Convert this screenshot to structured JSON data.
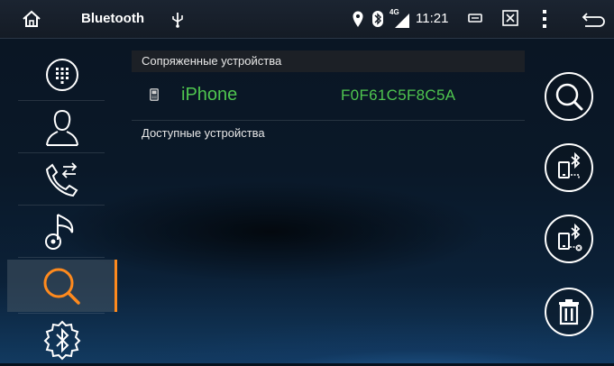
{
  "statusbar": {
    "title": "Bluetooth",
    "time": "11:21",
    "network": "4G",
    "icons": [
      "home-icon",
      "usb-icon",
      "location-icon",
      "bluetooth-icon",
      "signal-icon",
      "minimize-icon",
      "close-window-icon",
      "menu-icon",
      "back-icon"
    ]
  },
  "sidebar": {
    "items": [
      {
        "name": "dialpad",
        "icon": "dialpad-icon",
        "active": false
      },
      {
        "name": "contacts",
        "icon": "contact-icon",
        "active": false
      },
      {
        "name": "call-log",
        "icon": "call-log-icon",
        "active": false
      },
      {
        "name": "music",
        "icon": "music-icon",
        "active": false
      },
      {
        "name": "search",
        "icon": "search-icon",
        "active": true
      },
      {
        "name": "settings",
        "icon": "bluetooth-settings-icon",
        "active": false
      }
    ],
    "active_color": "#ff8a1d"
  },
  "paired": {
    "header": "Сопряженные устройства",
    "devices": [
      {
        "name": "iPhone",
        "address": "F0F61C5F8C5A"
      }
    ]
  },
  "available": {
    "header": "Доступные устройства"
  },
  "actions": [
    {
      "name": "search",
      "icon": "search-icon"
    },
    {
      "name": "connect",
      "icon": "phone-bluetooth-connect-icon"
    },
    {
      "name": "disconnect",
      "icon": "phone-bluetooth-disconnect-icon"
    },
    {
      "name": "delete",
      "icon": "trash-icon"
    }
  ],
  "colors": {
    "accent": "#4fc64f",
    "active": "#ff8a1d"
  }
}
